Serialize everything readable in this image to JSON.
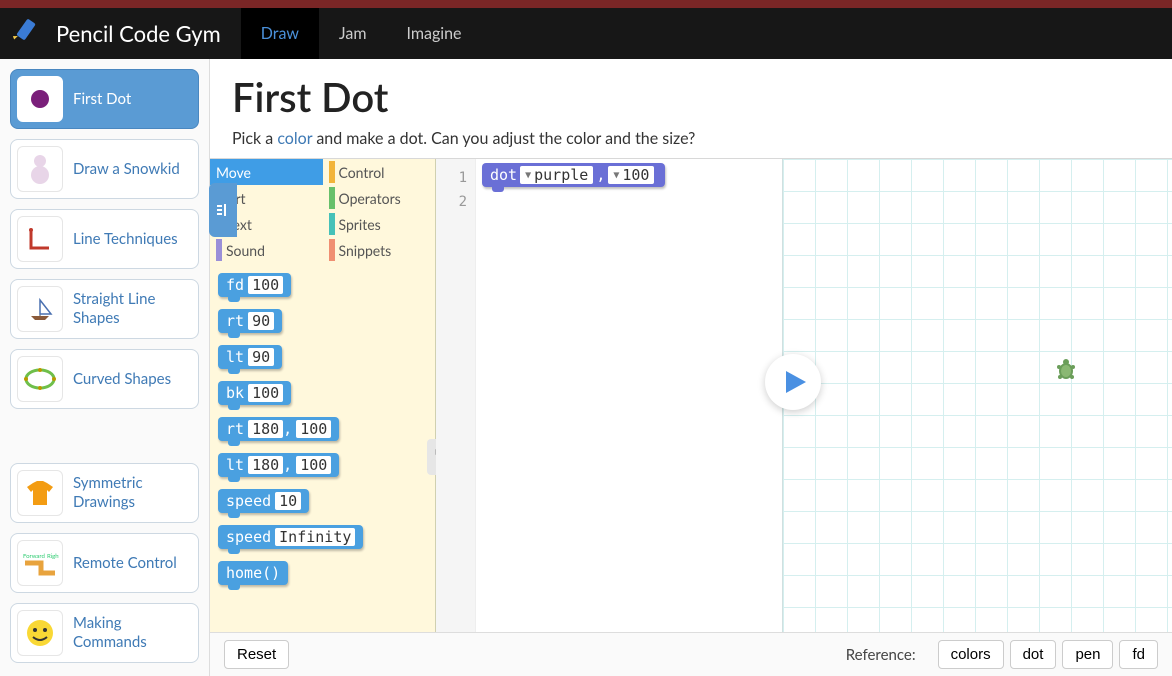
{
  "brand": "Pencil Code Gym",
  "nav": {
    "tabs": [
      "Draw",
      "Jam",
      "Imagine"
    ],
    "active": "Draw"
  },
  "sidebar": {
    "groups": [
      [
        {
          "label": "First Dot",
          "active": true,
          "icon": "dot"
        },
        {
          "label": "Draw a Snowkid",
          "icon": "snowman"
        },
        {
          "label": "Line Techniques",
          "icon": "redline"
        },
        {
          "label": "Straight Line Shapes",
          "icon": "sailboat"
        },
        {
          "label": "Curved Shapes",
          "icon": "greenoval"
        }
      ],
      [
        {
          "label": "Symmetric Drawings",
          "icon": "tshirt"
        },
        {
          "label": "Remote Control",
          "icon": "fwright"
        },
        {
          "label": "Making Commands",
          "icon": "smiley"
        }
      ]
    ]
  },
  "page": {
    "title": "First Dot",
    "subtitle_pre": "Pick a ",
    "subtitle_link": "color",
    "subtitle_post": " and make a dot. Can you adjust the color and the size?"
  },
  "palette": {
    "categories": [
      {
        "name": "Move",
        "color": "#3f9de6",
        "active": true
      },
      {
        "name": "Control",
        "color": "#f2b43a"
      },
      {
        "name": "Art",
        "color": "#8e6fc7"
      },
      {
        "name": "Operators",
        "color": "#67c06b"
      },
      {
        "name": "Text",
        "color": "#e56da1"
      },
      {
        "name": "Sprites",
        "color": "#46c1b8"
      },
      {
        "name": "Sound",
        "color": "#9a8fd8"
      },
      {
        "name": "Snippets",
        "color": "#f08f72"
      }
    ],
    "blocks": [
      {
        "cmd": "fd",
        "args": [
          "100"
        ]
      },
      {
        "cmd": "rt",
        "args": [
          "90"
        ]
      },
      {
        "cmd": "lt",
        "args": [
          "90"
        ]
      },
      {
        "cmd": "bk",
        "args": [
          "100"
        ]
      },
      {
        "cmd": "rt",
        "args": [
          "180",
          "100"
        ]
      },
      {
        "cmd": "lt",
        "args": [
          "180",
          "100"
        ]
      },
      {
        "cmd": "speed",
        "args": [
          "10"
        ]
      },
      {
        "cmd": "speed",
        "args": [
          "Infinity"
        ]
      },
      {
        "cmd": "home()",
        "args": []
      }
    ]
  },
  "editor": {
    "lines": [
      "1",
      "2"
    ],
    "code": {
      "cmd": "dot",
      "arg1": "purple",
      "arg2": "100"
    }
  },
  "footer": {
    "reset": "Reset",
    "reference_label": "Reference:",
    "refs": [
      "colors",
      "dot",
      "pen",
      "fd"
    ]
  }
}
